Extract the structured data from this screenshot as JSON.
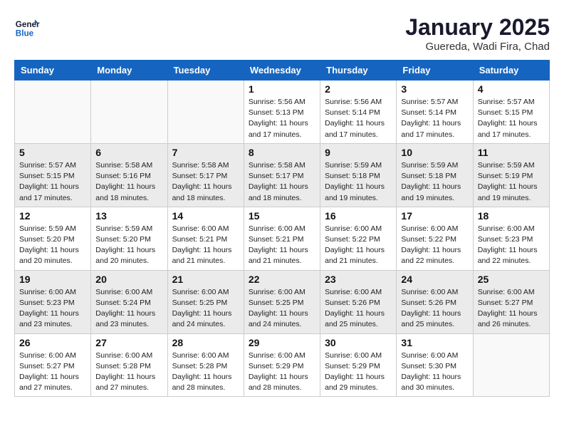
{
  "logo": {
    "line1": "General",
    "line2": "Blue"
  },
  "title": "January 2025",
  "subtitle": "Guereda, Wadi Fira, Chad",
  "days_of_week": [
    "Sunday",
    "Monday",
    "Tuesday",
    "Wednesday",
    "Thursday",
    "Friday",
    "Saturday"
  ],
  "weeks": [
    {
      "shaded": false,
      "days": [
        {
          "num": "",
          "info": ""
        },
        {
          "num": "",
          "info": ""
        },
        {
          "num": "",
          "info": ""
        },
        {
          "num": "1",
          "info": "Sunrise: 5:56 AM\nSunset: 5:13 PM\nDaylight: 11 hours\nand 17 minutes."
        },
        {
          "num": "2",
          "info": "Sunrise: 5:56 AM\nSunset: 5:14 PM\nDaylight: 11 hours\nand 17 minutes."
        },
        {
          "num": "3",
          "info": "Sunrise: 5:57 AM\nSunset: 5:14 PM\nDaylight: 11 hours\nand 17 minutes."
        },
        {
          "num": "4",
          "info": "Sunrise: 5:57 AM\nSunset: 5:15 PM\nDaylight: 11 hours\nand 17 minutes."
        }
      ]
    },
    {
      "shaded": true,
      "days": [
        {
          "num": "5",
          "info": "Sunrise: 5:57 AM\nSunset: 5:15 PM\nDaylight: 11 hours\nand 17 minutes."
        },
        {
          "num": "6",
          "info": "Sunrise: 5:58 AM\nSunset: 5:16 PM\nDaylight: 11 hours\nand 18 minutes."
        },
        {
          "num": "7",
          "info": "Sunrise: 5:58 AM\nSunset: 5:17 PM\nDaylight: 11 hours\nand 18 minutes."
        },
        {
          "num": "8",
          "info": "Sunrise: 5:58 AM\nSunset: 5:17 PM\nDaylight: 11 hours\nand 18 minutes."
        },
        {
          "num": "9",
          "info": "Sunrise: 5:59 AM\nSunset: 5:18 PM\nDaylight: 11 hours\nand 19 minutes."
        },
        {
          "num": "10",
          "info": "Sunrise: 5:59 AM\nSunset: 5:18 PM\nDaylight: 11 hours\nand 19 minutes."
        },
        {
          "num": "11",
          "info": "Sunrise: 5:59 AM\nSunset: 5:19 PM\nDaylight: 11 hours\nand 19 minutes."
        }
      ]
    },
    {
      "shaded": false,
      "days": [
        {
          "num": "12",
          "info": "Sunrise: 5:59 AM\nSunset: 5:20 PM\nDaylight: 11 hours\nand 20 minutes."
        },
        {
          "num": "13",
          "info": "Sunrise: 5:59 AM\nSunset: 5:20 PM\nDaylight: 11 hours\nand 20 minutes."
        },
        {
          "num": "14",
          "info": "Sunrise: 6:00 AM\nSunset: 5:21 PM\nDaylight: 11 hours\nand 21 minutes."
        },
        {
          "num": "15",
          "info": "Sunrise: 6:00 AM\nSunset: 5:21 PM\nDaylight: 11 hours\nand 21 minutes."
        },
        {
          "num": "16",
          "info": "Sunrise: 6:00 AM\nSunset: 5:22 PM\nDaylight: 11 hours\nand 21 minutes."
        },
        {
          "num": "17",
          "info": "Sunrise: 6:00 AM\nSunset: 5:22 PM\nDaylight: 11 hours\nand 22 minutes."
        },
        {
          "num": "18",
          "info": "Sunrise: 6:00 AM\nSunset: 5:23 PM\nDaylight: 11 hours\nand 22 minutes."
        }
      ]
    },
    {
      "shaded": true,
      "days": [
        {
          "num": "19",
          "info": "Sunrise: 6:00 AM\nSunset: 5:23 PM\nDaylight: 11 hours\nand 23 minutes."
        },
        {
          "num": "20",
          "info": "Sunrise: 6:00 AM\nSunset: 5:24 PM\nDaylight: 11 hours\nand 23 minutes."
        },
        {
          "num": "21",
          "info": "Sunrise: 6:00 AM\nSunset: 5:25 PM\nDaylight: 11 hours\nand 24 minutes."
        },
        {
          "num": "22",
          "info": "Sunrise: 6:00 AM\nSunset: 5:25 PM\nDaylight: 11 hours\nand 24 minutes."
        },
        {
          "num": "23",
          "info": "Sunrise: 6:00 AM\nSunset: 5:26 PM\nDaylight: 11 hours\nand 25 minutes."
        },
        {
          "num": "24",
          "info": "Sunrise: 6:00 AM\nSunset: 5:26 PM\nDaylight: 11 hours\nand 25 minutes."
        },
        {
          "num": "25",
          "info": "Sunrise: 6:00 AM\nSunset: 5:27 PM\nDaylight: 11 hours\nand 26 minutes."
        }
      ]
    },
    {
      "shaded": false,
      "days": [
        {
          "num": "26",
          "info": "Sunrise: 6:00 AM\nSunset: 5:27 PM\nDaylight: 11 hours\nand 27 minutes."
        },
        {
          "num": "27",
          "info": "Sunrise: 6:00 AM\nSunset: 5:28 PM\nDaylight: 11 hours\nand 27 minutes."
        },
        {
          "num": "28",
          "info": "Sunrise: 6:00 AM\nSunset: 5:28 PM\nDaylight: 11 hours\nand 28 minutes."
        },
        {
          "num": "29",
          "info": "Sunrise: 6:00 AM\nSunset: 5:29 PM\nDaylight: 11 hours\nand 28 minutes."
        },
        {
          "num": "30",
          "info": "Sunrise: 6:00 AM\nSunset: 5:29 PM\nDaylight: 11 hours\nand 29 minutes."
        },
        {
          "num": "31",
          "info": "Sunrise: 6:00 AM\nSunset: 5:30 PM\nDaylight: 11 hours\nand 30 minutes."
        },
        {
          "num": "",
          "info": ""
        }
      ]
    }
  ]
}
